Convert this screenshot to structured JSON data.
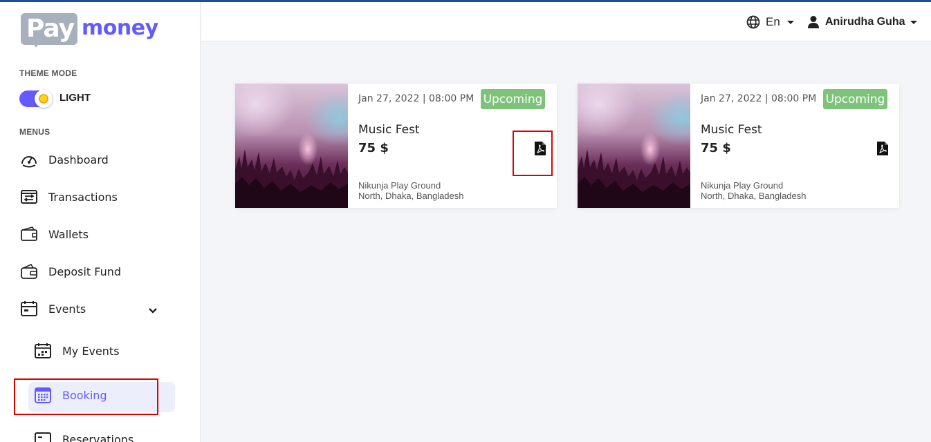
{
  "brand": {
    "logo_pay": "Pay",
    "logo_money": "money",
    "accent": "#635bff"
  },
  "sidebar": {
    "theme_mode_label": "THEME MODE",
    "theme_value": "LIGHT",
    "menus_label": "MENUS",
    "items": [
      {
        "label": "Dashboard",
        "icon": "speedometer-icon"
      },
      {
        "label": "Transactions",
        "icon": "transfer-icon"
      },
      {
        "label": "Wallets",
        "icon": "wallet-icon"
      },
      {
        "label": "Deposit Fund",
        "icon": "deposit-wallet-icon"
      },
      {
        "label": "Events",
        "icon": "calendar-icon"
      }
    ],
    "subitems": [
      {
        "label": "My Events",
        "icon": "calendar-grid-icon"
      },
      {
        "label": "Booking",
        "icon": "calendar-booking-icon",
        "active": true
      },
      {
        "label": "Reservations",
        "icon": "reservation-icon"
      }
    ]
  },
  "header": {
    "language": "En",
    "user_name": "Anirudha Guha"
  },
  "events": [
    {
      "datetime": "Jan 27, 2022 | 08:00 PM",
      "status": "Upcoming",
      "title": "Music Fest",
      "price": "75 $",
      "location_line1": "Nikunja Play Ground",
      "location_line2": "North, Dhaka, Bangladesh"
    },
    {
      "datetime": "Jan 27, 2022 | 08:00 PM",
      "status": "Upcoming",
      "title": "Music Fest",
      "price": "75 $",
      "location_line1": "Nikunja Play Ground",
      "location_line2": "North, Dhaka, Bangladesh"
    }
  ]
}
